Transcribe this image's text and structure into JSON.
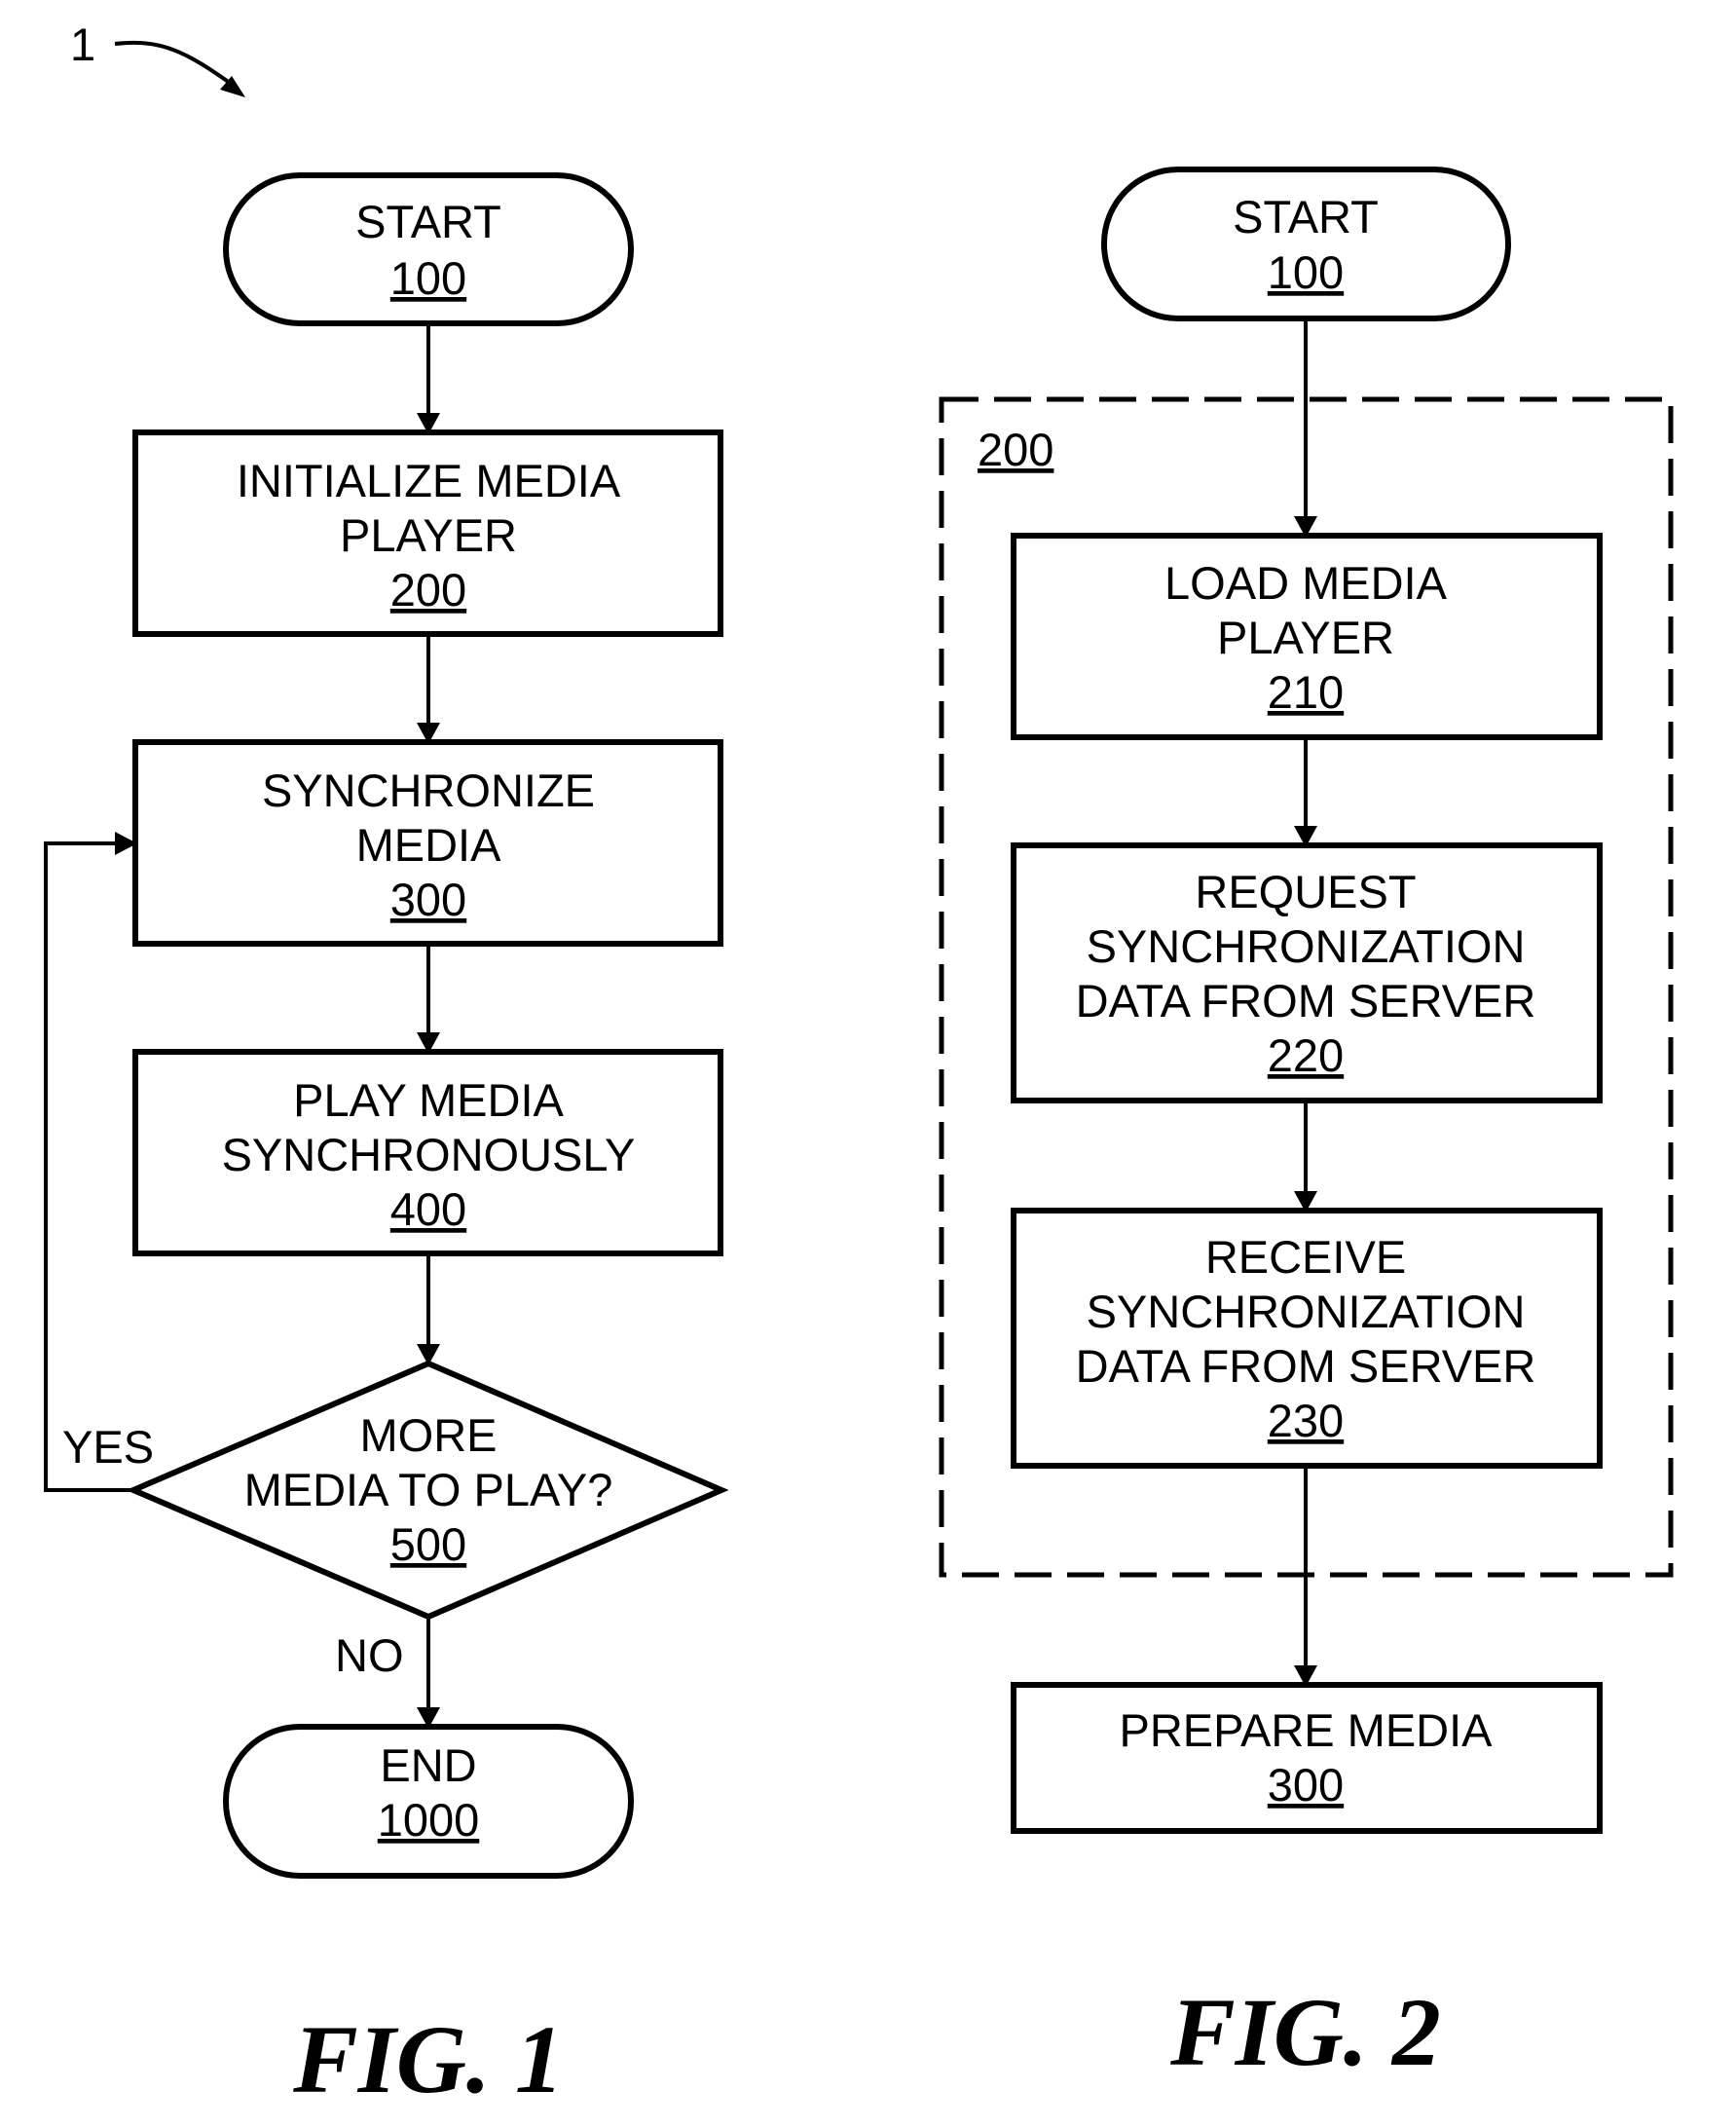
{
  "reference_numeral": "1",
  "figures": [
    {
      "caption": "FIG. 1",
      "nodes": [
        {
          "id": "start",
          "shape": "terminal",
          "lines": [
            "START"
          ],
          "ref": "100"
        },
        {
          "id": "initialize",
          "shape": "process",
          "lines": [
            "INITIALIZE MEDIA",
            "PLAYER"
          ],
          "ref": "200"
        },
        {
          "id": "synchronize",
          "shape": "process",
          "lines": [
            "SYNCHRONIZE",
            "MEDIA"
          ],
          "ref": "300"
        },
        {
          "id": "play",
          "shape": "process",
          "lines": [
            "PLAY MEDIA",
            "SYNCHRONOUSLY"
          ],
          "ref": "400"
        },
        {
          "id": "decision",
          "shape": "decision",
          "lines": [
            "MORE",
            "MEDIA TO PLAY?"
          ],
          "ref": "500"
        },
        {
          "id": "end",
          "shape": "terminal",
          "lines": [
            "END"
          ],
          "ref": "1000"
        }
      ],
      "edges": [
        {
          "from": "start",
          "to": "initialize",
          "label": ""
        },
        {
          "from": "initialize",
          "to": "synchronize",
          "label": ""
        },
        {
          "from": "synchronize",
          "to": "play",
          "label": ""
        },
        {
          "from": "play",
          "to": "decision",
          "label": ""
        },
        {
          "from": "decision",
          "to": "synchronize",
          "label": "YES"
        },
        {
          "from": "decision",
          "to": "end",
          "label": "NO"
        }
      ]
    },
    {
      "caption": "FIG. 2",
      "group": {
        "ref": "200",
        "style": "dashed"
      },
      "nodes": [
        {
          "id": "start",
          "shape": "terminal",
          "lines": [
            "START"
          ],
          "ref": "100"
        },
        {
          "id": "load",
          "shape": "process",
          "lines": [
            "LOAD MEDIA",
            "PLAYER"
          ],
          "ref": "210"
        },
        {
          "id": "request",
          "shape": "process",
          "lines": [
            "REQUEST",
            "SYNCHRONIZATION",
            "DATA FROM SERVER"
          ],
          "ref": "220"
        },
        {
          "id": "receive",
          "shape": "process",
          "lines": [
            "RECEIVE",
            "SYNCHRONIZATION",
            "DATA FROM SERVER"
          ],
          "ref": "230"
        },
        {
          "id": "prepare",
          "shape": "process",
          "lines": [
            "PREPARE MEDIA"
          ],
          "ref": "300"
        }
      ],
      "edges": [
        {
          "from": "start",
          "to": "load",
          "label": ""
        },
        {
          "from": "load",
          "to": "request",
          "label": ""
        },
        {
          "from": "request",
          "to": "receive",
          "label": ""
        },
        {
          "from": "receive",
          "to": "prepare",
          "label": ""
        }
      ]
    }
  ]
}
